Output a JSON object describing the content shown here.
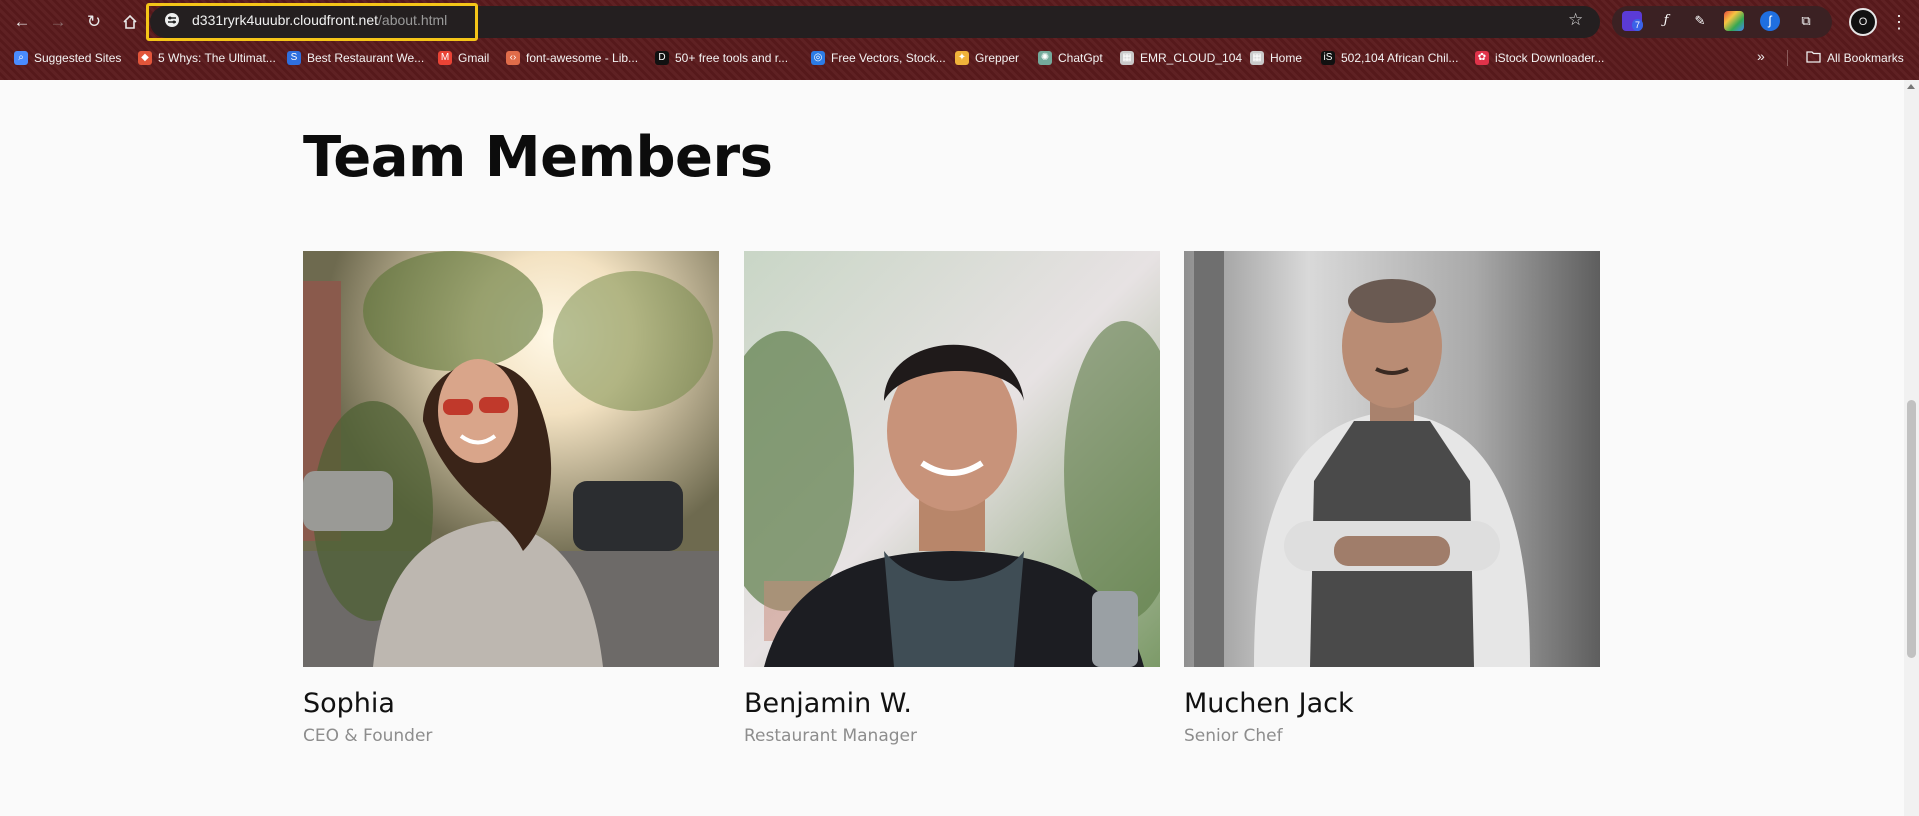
{
  "browser": {
    "url_host": "d331ryrk4uuubr.cloudfront.net",
    "url_path": "/about.html",
    "profile_initial": "O",
    "extension_badge": "7",
    "bookmarks": [
      {
        "label": "Suggested Sites",
        "icon": "search-icon",
        "color": "#4a8cff"
      },
      {
        "label": "5 Whys: The Ultimat...",
        "icon": "diamond-icon",
        "color": "#e2553a"
      },
      {
        "label": "Best Restaurant We...",
        "icon": "s-icon",
        "color": "#2f6fde"
      },
      {
        "label": "Gmail",
        "icon": "gmail-icon",
        "color": "#ea4335"
      },
      {
        "label": "font-awesome - Lib...",
        "icon": "code-icon",
        "color": "#e06c4a"
      },
      {
        "label": "50+ free tools and r...",
        "icon": "dev-icon",
        "color": "#111111"
      },
      {
        "label": "Free Vectors, Stock...",
        "icon": "globe-icon",
        "color": "#2c7be5"
      },
      {
        "label": "Grepper",
        "icon": "grepper-icon",
        "color": "#f0b23a"
      },
      {
        "label": "ChatGpt",
        "icon": "chatgpt-icon",
        "color": "#74aa9c"
      },
      {
        "label": "EMR_CLOUD_104",
        "icon": "grid-icon",
        "color": "#c9c9c9"
      },
      {
        "label": "Home",
        "icon": "grid-icon",
        "color": "#c9c9c9"
      },
      {
        "label": "502,104 African Chil...",
        "icon": "istock-icon",
        "color": "#111111"
      },
      {
        "label": "iStock Downloader...",
        "icon": "flower-icon",
        "color": "#e0334a"
      }
    ],
    "more_label": "»",
    "all_bookmarks": "All Bookmarks"
  },
  "page": {
    "title": "Team Members",
    "members": [
      {
        "name": "Sophia",
        "role": "CEO & Founder",
        "photo": "woman-with-sunglasses-photo"
      },
      {
        "name": "Benjamin W.",
        "role": "Restaurant Manager",
        "photo": "smiling-man-with-scarf-photo"
      },
      {
        "name": "Muchen Jack",
        "role": "Senior Chef",
        "photo": "chef-in-apron-photo"
      }
    ]
  },
  "colors": {
    "chrome_bg": "#5a1a1c",
    "url_highlight": "#f5c518",
    "page_bg": "#fafafa",
    "role_text": "#8d8d8d"
  }
}
